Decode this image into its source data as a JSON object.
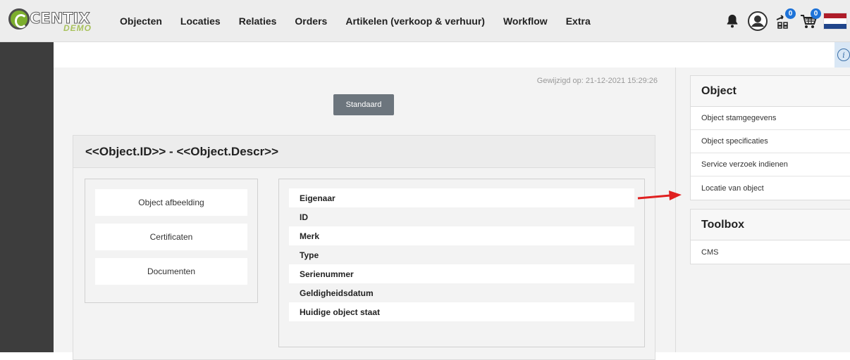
{
  "brand": {
    "name": "CENTIX",
    "subtitle": "DEMO"
  },
  "nav": {
    "items": [
      "Objecten",
      "Locaties",
      "Relaties",
      "Orders",
      "Artikelen (verkoop & verhuur)",
      "Workflow",
      "Extra"
    ]
  },
  "header_icons": {
    "bell": "bell-icon",
    "user": "user-icon",
    "compare": "compare-icon",
    "compare_badge": "0",
    "cart": "cart-icon",
    "cart_badge": "0",
    "flag": "flag-nl-icon",
    "flag_colors": [
      "#ae1c28",
      "#ffffff",
      "#21468b"
    ]
  },
  "info": {
    "icon": "info-icon",
    "glyph": "i"
  },
  "main": {
    "modified": "Gewijzigd op: 21-12-2021 15:29:26",
    "standard_button": "Standaard",
    "card_title": "<<Object.ID>> - <<Object.Descr>>",
    "left_buttons": [
      "Object afbeelding",
      "Certificaten",
      "Documenten"
    ],
    "fields": [
      "Eigenaar",
      "ID",
      "Merk",
      "Type",
      "Serienummer",
      "Geldigheidsdatum",
      "Huidige object staat"
    ]
  },
  "sidebar": {
    "object": {
      "title": "Object",
      "items": [
        "Object stamgegevens",
        "Object specificaties",
        "Service verzoek indienen",
        "Locatie van object"
      ]
    },
    "toolbox": {
      "title": "Toolbox",
      "items": [
        "CMS"
      ]
    }
  },
  "colors": {
    "accent_button": "#6c757d",
    "badge": "#1e73d8",
    "arrow": "#e02020",
    "sidebar_dark": "#3d3d3d"
  }
}
